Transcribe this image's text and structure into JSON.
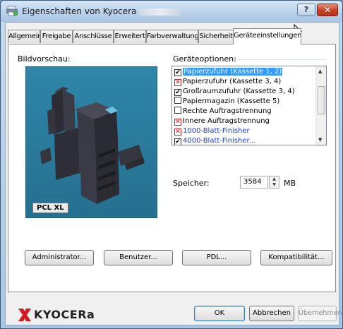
{
  "window": {
    "title": "Eigenschaften von Kyocera",
    "help_label": "?",
    "close_label": "✕"
  },
  "tabs": [
    {
      "label": "Allgemein"
    },
    {
      "label": "Freigabe"
    },
    {
      "label": "Anschlüsse"
    },
    {
      "label": "Erweitert"
    },
    {
      "label": "Farbverwaltung"
    },
    {
      "label": "Sicherheit"
    },
    {
      "label": "Geräteeinstellungen",
      "active": true
    }
  ],
  "preview": {
    "label": "Bildvorschau:",
    "pdl_badge": "PCL XL"
  },
  "options": {
    "label": "Geräteoptionen:",
    "items": [
      {
        "label": "Papierzufuhr (Kassette 1, 2)",
        "state": "checked",
        "selected": true
      },
      {
        "label": "Papierzufuhr (Kassette 3, 4)",
        "state": "conflict"
      },
      {
        "label": "Großraumzufuhr (Kassette 3, 4)",
        "state": "checked"
      },
      {
        "label": "Papiermagazin (Kassette 5)",
        "state": "unchecked"
      },
      {
        "label": "Rechte Auftragstrennung",
        "state": "unchecked"
      },
      {
        "label": "Innere Auftragstrennung",
        "state": "conflict"
      },
      {
        "label": "1000-Blatt-Finisher",
        "state": "conflict",
        "blue": true
      },
      {
        "label": "4000-Blatt-Finisher...",
        "state": "checked",
        "blue": true
      }
    ]
  },
  "memory": {
    "label": "Speicher:",
    "value": "3584",
    "unit": "MB"
  },
  "buttons": {
    "administrator": "Administrator...",
    "benutzer": "Benutzer...",
    "pdl": "PDL...",
    "kompatibilitaet": "Kompatibilität..."
  },
  "footer": {
    "brand": "KYOCERa",
    "ok": "OK",
    "cancel": "Abbrechen",
    "apply": "Übernehmen"
  }
}
